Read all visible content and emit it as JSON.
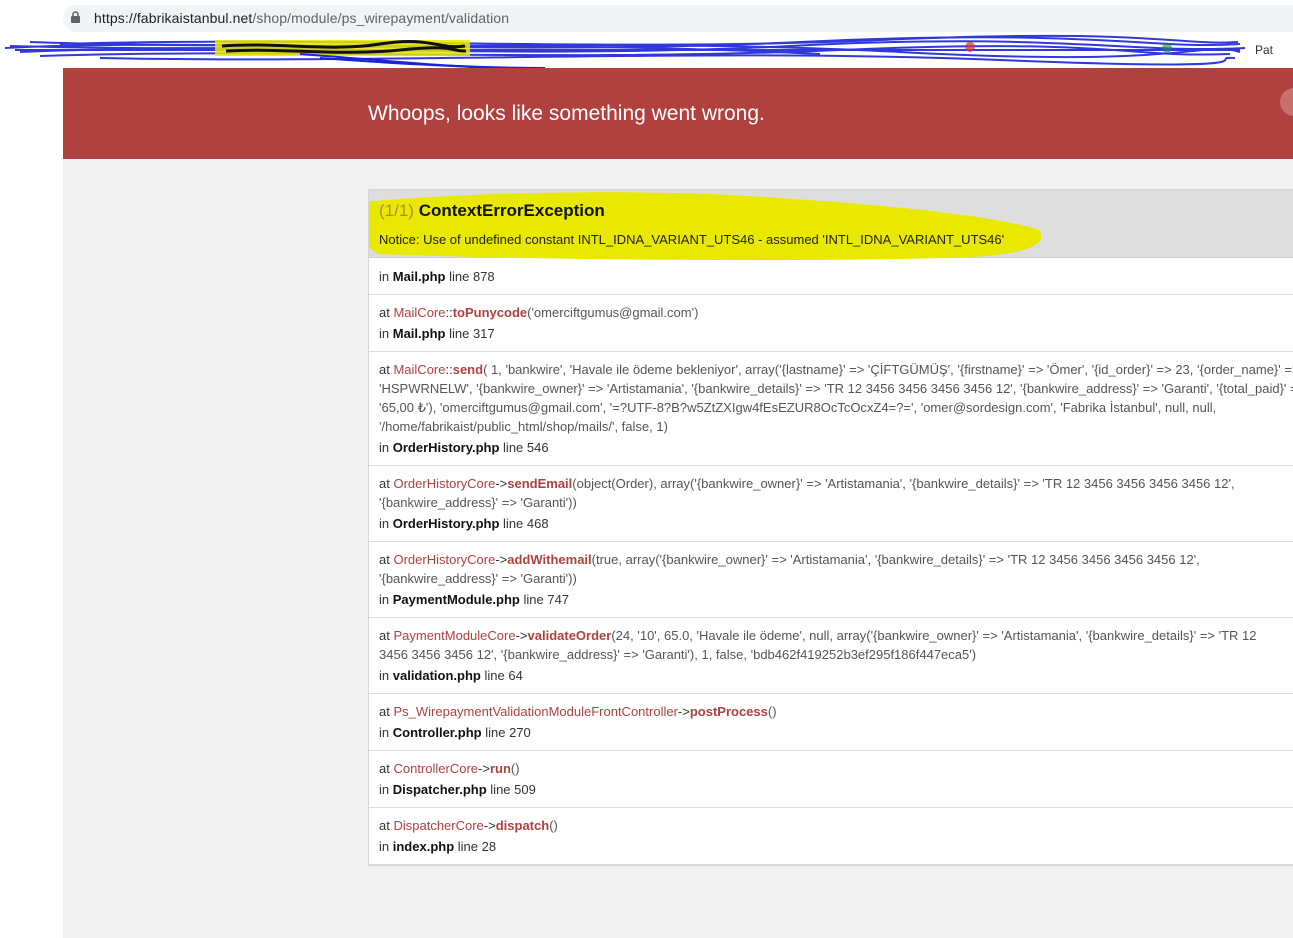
{
  "browser": {
    "url_domain": "https://fabrikaistanbul.net",
    "url_path": "/shop/module/ps_wirepayment/validation",
    "bookmark_partial": "Pat"
  },
  "error": {
    "header_title": "Whoops, looks like something went wrong.",
    "count_label": "(1/1)",
    "exception_class": "ContextErrorException",
    "message": "Notice: Use of undefined constant INTL_IDNA_VARIANT_UTS46 - assumed 'INTL_IDNA_VARIANT_UTS46'"
  },
  "trace": [
    {
      "id": "f0",
      "file_prefix": "in",
      "file": "Mail.php",
      "line": "line 878"
    },
    {
      "id": "f1",
      "at": "at",
      "class": "MailCore",
      "op": "::",
      "method": "toPunycode",
      "args": [
        "('omerciftgumus@gmail.com')"
      ],
      "file_prefix": "in",
      "file": "Mail.php",
      "line": "line 317"
    },
    {
      "id": "f2",
      "at": "at",
      "class": "MailCore",
      "op": "::",
      "method": "send",
      "args": [
        "( 1, 'bankwire', 'Havale ile ödeme bekleniyor', array('{lastname}' => 'ÇİFTGÜMÜŞ', '{firstname}' => 'Ömer', '{id_order}' => 23, '{order_name}' =>",
        "'HSPWRNELW', '{bankwire_owner}' => 'Artistamania', '{bankwire_details}' => 'TR 12 3456 3456 3456 3456 12', '{bankwire_address}' => 'Garanti', '{total_paid}' =>",
        "'65,00 ₺'), 'omerciftgumus@gmail.com', '=?UTF-8?B?w5ZtZXIgw4fEsEZUR8OcTcOcxZ4=?=', 'omer@sordesign.com', 'Fabrika İstanbul', null, null,",
        "'/home/fabrikaist/public_html/shop/mails/', false, 1)"
      ],
      "file_prefix": "in",
      "file": "OrderHistory.php",
      "line": "line 546"
    },
    {
      "id": "f3",
      "at": "at",
      "class": "OrderHistoryCore",
      "op": "->",
      "method": "sendEmail",
      "args": [
        "(object(Order), array('{bankwire_owner}' => 'Artistamania', '{bankwire_details}' => 'TR 12 3456 3456 3456 3456 12',",
        "'{bankwire_address}' => 'Garanti'))"
      ],
      "file_prefix": "in",
      "file": "OrderHistory.php",
      "line": "line 468"
    },
    {
      "id": "f4",
      "at": "at",
      "class": "OrderHistoryCore",
      "op": "->",
      "method": "addWithemail",
      "args": [
        "(true, array('{bankwire_owner}' => 'Artistamania', '{bankwire_details}' => 'TR 12 3456 3456 3456 3456 12',",
        "'{bankwire_address}' => 'Garanti'))"
      ],
      "file_prefix": "in",
      "file": "PaymentModule.php",
      "line": "line 747"
    },
    {
      "id": "f5",
      "at": "at",
      "class": "PaymentModuleCore",
      "op": "->",
      "method": "validateOrder",
      "args": [
        "(24, '10', 65.0, 'Havale ile ödeme', null, array('{bankwire_owner}' => 'Artistamania', '{bankwire_details}' => 'TR 12",
        "3456 3456 3456 12', '{bankwire_address}' => 'Garanti'), 1, false, 'bdb462f419252b3ef295f186f447eca5')"
      ],
      "file_prefix": "in",
      "file": "validation.php",
      "line": "line 64"
    },
    {
      "id": "f6",
      "at": "at",
      "class": "Ps_WirepaymentValidationModuleFrontController",
      "op": "->",
      "method": "postProcess",
      "args": [
        "()"
      ],
      "file_prefix": "in",
      "file": "Controller.php",
      "line": "line 270"
    },
    {
      "id": "f7",
      "at": "at",
      "class": "ControllerCore",
      "op": "->",
      "method": "run",
      "args": [
        "()"
      ],
      "file_prefix": "in",
      "file": "Dispatcher.php",
      "line": "line 509"
    },
    {
      "id": "f8",
      "at": "at",
      "class": "DispatcherCore",
      "op": "->",
      "method": "dispatch",
      "args": [
        "()"
      ],
      "file_prefix": "in",
      "file": "index.php",
      "line": "line 28"
    }
  ],
  "colors": {
    "header_bg": "#b0413e",
    "highlight": "#e8e800",
    "scribble": "#1a23d6"
  },
  "icons": [
    "lock-icon",
    "profile-icon"
  ]
}
